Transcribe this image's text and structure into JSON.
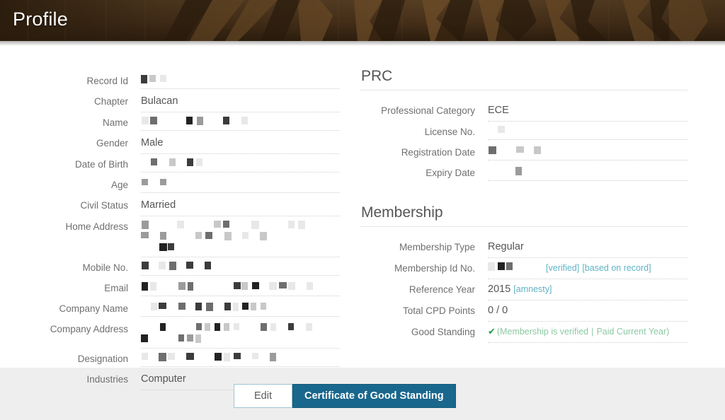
{
  "page": {
    "title": "Profile",
    "banner_color": "#4a3322",
    "accent_color": "#19678c",
    "link_color": "#5fb3c6",
    "verified_color": "#8cc9a3",
    "check_color": "#1e9e4a"
  },
  "left_section": {
    "fields": [
      {
        "label": "Record Id",
        "value": "",
        "redacted": true,
        "lines": 1
      },
      {
        "label": "Chapter",
        "value": "Bulacan",
        "redacted": false,
        "lines": 1
      },
      {
        "label": "Name",
        "value": "",
        "redacted": true,
        "lines": 1
      },
      {
        "label": "Gender",
        "value": "Male",
        "redacted": false,
        "lines": 1
      },
      {
        "label": "Date of Birth",
        "value": "",
        "redacted": true,
        "lines": 1
      },
      {
        "label": "Age",
        "value": "",
        "redacted": true,
        "lines": 1
      },
      {
        "label": "Civil Status",
        "value": "Married",
        "redacted": false,
        "lines": 1
      },
      {
        "label": "Home Address",
        "value": "",
        "redacted": true,
        "lines": 3
      },
      {
        "label": "Mobile No.",
        "value": "",
        "redacted": true,
        "lines": 1
      },
      {
        "label": "Email",
        "value": "",
        "redacted": true,
        "lines": 1
      },
      {
        "label": "Company Name",
        "value": "",
        "redacted": true,
        "lines": 1
      },
      {
        "label": "Company Address",
        "value": "",
        "redacted": true,
        "lines": 2
      },
      {
        "label": "Designation",
        "value": "",
        "redacted": true,
        "lines": 1
      },
      {
        "label": "Industries",
        "value": "Computer",
        "redacted": false,
        "lines": 1
      }
    ]
  },
  "prc_section": {
    "heading": "PRC",
    "fields": [
      {
        "label": "Professional Category",
        "value": "ECE",
        "redacted": false
      },
      {
        "label": "License No.",
        "value": "",
        "redacted": true
      },
      {
        "label": "Registration Date",
        "value": "",
        "redacted": true
      },
      {
        "label": "Expiry Date",
        "value": "",
        "redacted": true
      }
    ]
  },
  "membership_section": {
    "heading": "Membership",
    "type_label": "Membership Type",
    "type_value": "Regular",
    "id_label": "Membership Id No.",
    "id_value": "",
    "id_tag_verified": "[verified]",
    "id_tag_based_on_record": "[based on record]",
    "refyear_label": "Reference Year",
    "refyear_value": "2015",
    "refyear_tag": "[amnesty]",
    "cpd_label": "Total CPD Points",
    "cpd_value": "0 / 0",
    "standing_label": "Good Standing",
    "standing_check": "✔",
    "standing_open": "(",
    "standing_link1": "Membership is verified",
    "standing_sep": "|",
    "standing_link2": "Paid Current Year",
    "standing_close": ")"
  },
  "actions": {
    "edit_label": "Edit",
    "certificate_label": "Certificate of Good Standing"
  }
}
